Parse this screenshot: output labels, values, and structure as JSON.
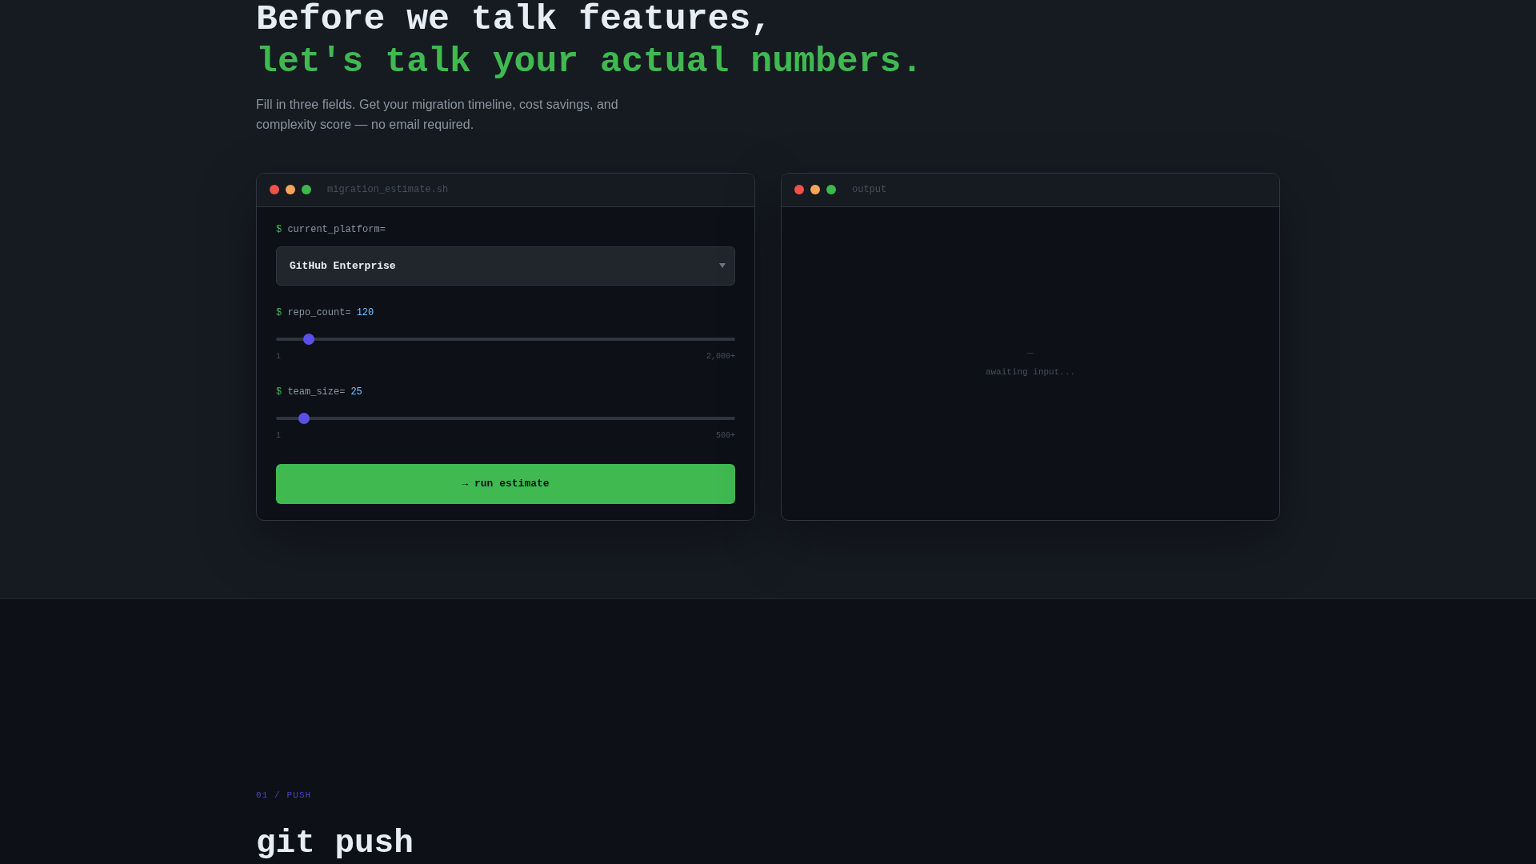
{
  "hero": {
    "title_line_1": "Before we talk features,",
    "title_line_2": "let's talk your actual numbers.",
    "subtitle": "Fill in three fields. Get your migration timeline, cost savings, and complexity score — no email required."
  },
  "estimator": {
    "window_title": "migration_estimate.sh",
    "fields": [
      {
        "kind": "select",
        "prompt": "$",
        "label": "current_platform=",
        "value": "GitHub Enterprise"
      },
      {
        "kind": "slider",
        "prompt": "$",
        "label": "repo_count=",
        "value": "120",
        "level": 0.06,
        "min_label": "1",
        "max_label": "2,000+"
      },
      {
        "kind": "slider",
        "prompt": "$",
        "label": "team_size=",
        "value": "25",
        "level": 0.05,
        "min_label": "1",
        "max_label": "500+"
      }
    ],
    "button": "→ run estimate"
  },
  "output": {
    "window_title": "output",
    "cursor": "_",
    "status": "awaiting input..."
  },
  "next_section": {
    "eyebrow": "01 / PUSH",
    "title": "git push"
  }
}
